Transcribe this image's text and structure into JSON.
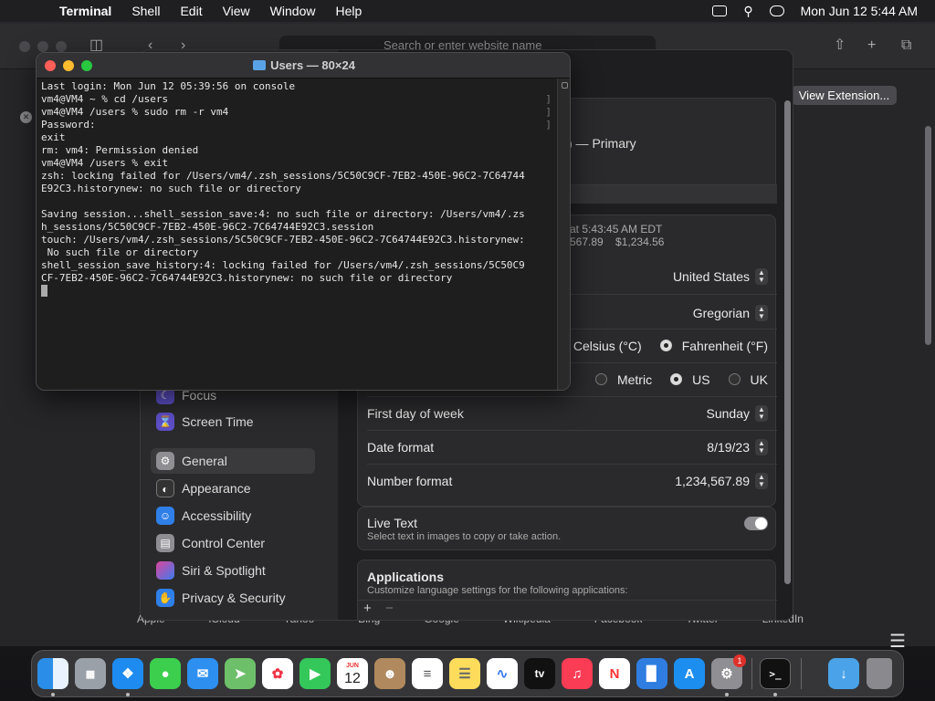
{
  "menubar": {
    "app_name": "Terminal",
    "menus": [
      "Shell",
      "Edit",
      "View",
      "Window",
      "Help"
    ],
    "clock": "Mon Jun 12  5:44 AM"
  },
  "safari": {
    "url_placeholder": "Search or enter website name",
    "view_extension_label": "View Extension...",
    "favorites": [
      "Apple",
      "iCloud",
      "Yahoo",
      "Bing",
      "Google",
      "Wikipedia",
      "Facebook",
      "Twitter",
      "LinkedIn"
    ]
  },
  "settings": {
    "sidebar": {
      "focus": "Focus",
      "screen_time": "Screen Time",
      "general": "General",
      "appearance": "Appearance",
      "accessibility": "Accessibility",
      "control_center": "Control Center",
      "siri": "Siri & Spotlight",
      "privacy": "Privacy & Security"
    },
    "primary_fragment": ") — Primary",
    "date_fragment": "at 5:43:45 AM EDT",
    "number_fragment": "567.89",
    "currency_fragment": "$1,234.56",
    "region": "United States",
    "calendar": "Gregorian",
    "temp_celsius": "Celsius (°C)",
    "temp_fahrenheit": "Fahrenheit (°F)",
    "measure_metric": "Metric",
    "measure_us": "US",
    "measure_uk": "UK",
    "first_day_label": "First day of week",
    "first_day_value": "Sunday",
    "date_format_label": "Date format",
    "date_format_value": "8/19/23",
    "number_format_label": "Number format",
    "number_format_value": "1,234,567.89",
    "live_text_title": "Live Text",
    "live_text_desc": "Select text in images to copy or take action.",
    "applications_title": "Applications",
    "applications_desc": "Customize language settings for the following applications:"
  },
  "terminal": {
    "title": "Users — 80×24",
    "lines": [
      "Last login: Mon Jun 12 05:39:56 on console",
      "vm4@VM4 ~ % cd /users",
      "vm4@VM4 /users % sudo rm -r vm4",
      "Password:",
      "exit",
      "rm: vm4: Permission denied",
      "vm4@VM4 /users % exit",
      "zsh: locking failed for /Users/vm4/.zsh_sessions/5C50C9CF-7EB2-450E-96C2-7C64744",
      "E92C3.historynew: no such file or directory",
      "",
      "Saving session...shell_session_save:4: no such file or directory: /Users/vm4/.zs",
      "h_sessions/5C50C9CF-7EB2-450E-96C2-7C64744E92C3.session",
      "touch: /Users/vm4/.zsh_sessions/5C50C9CF-7EB2-450E-96C2-7C64744E92C3.historynew:",
      " No such file or directory",
      "shell_session_save_history:4: locking failed for /Users/vm4/.zsh_sessions/5C50C9",
      "CF-7EB2-450E-96C2-7C64744E92C3.historynew: no such file or directory"
    ]
  },
  "dock": {
    "calendar_month": "JUN",
    "calendar_day": "12",
    "tv_label": "tv",
    "settings_badge": "1"
  }
}
